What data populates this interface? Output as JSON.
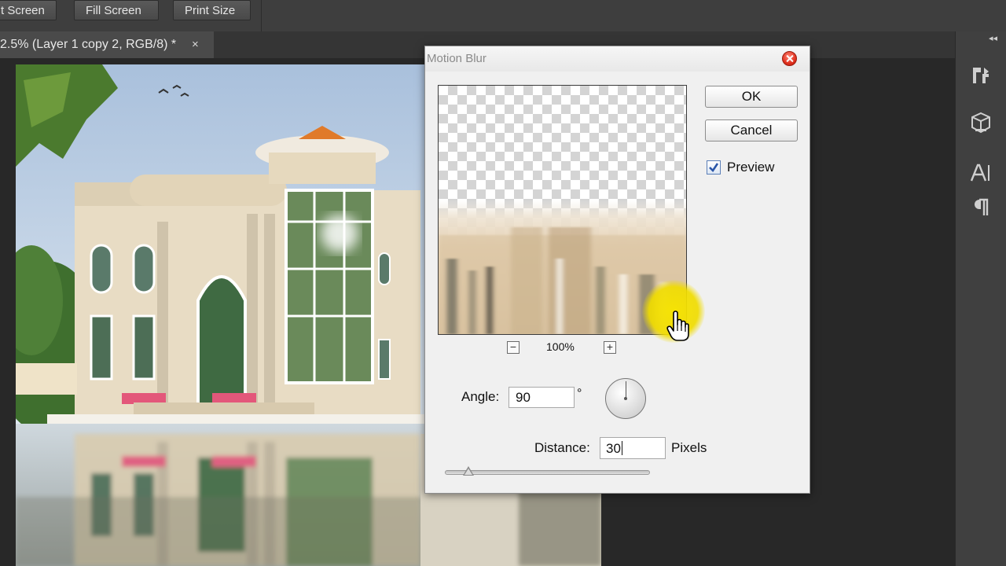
{
  "toolbar": {
    "buttons": [
      "t Screen",
      "Fill Screen",
      "Print Size"
    ]
  },
  "document": {
    "tab_title": "2.5% (Layer 1 copy 2, RGB/8) *",
    "close_glyph": "×"
  },
  "right_panel": {
    "collapse_glyph": "◂◂",
    "icons": [
      "history-icon",
      "3d-icon",
      "character-icon",
      "paragraph-icon"
    ]
  },
  "dialog": {
    "title": "Motion Blur",
    "ok_label": "OK",
    "cancel_label": "Cancel",
    "preview_label": "Preview",
    "preview_checked": true,
    "zoom_out_glyph": "−",
    "zoom_in_glyph": "+",
    "zoom_level": "100%",
    "angle_label": "Angle:",
    "angle_value": "90",
    "degree_symbol": "°",
    "distance_label": "Distance:",
    "distance_value": "30",
    "distance_unit": "Pixels",
    "distance_slider_fraction": 0.115
  },
  "colors": {
    "highlight": "#f6e400",
    "check_blue": "#2a56a8",
    "close_red": "#e0301e"
  }
}
